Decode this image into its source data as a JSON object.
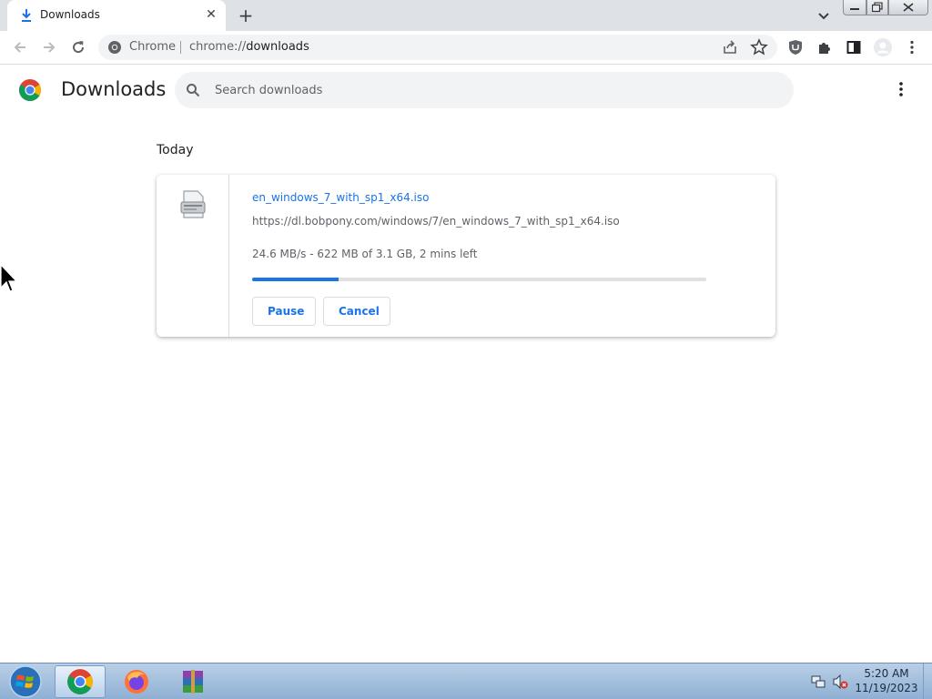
{
  "browser": {
    "tab": {
      "title": "Downloads",
      "close_glyph": "✕",
      "icon": "download-icon"
    },
    "new_tab_glyph": "+",
    "omnibox": {
      "chip_label": "Chrome",
      "url_scheme": "chrome://",
      "url_path": "downloads"
    }
  },
  "page": {
    "title": "Downloads",
    "search_placeholder": "Search downloads",
    "section_title": "Today"
  },
  "download": {
    "file_name": "en_windows_7_with_sp1_x64.iso",
    "url": "https://dl.bobpony.com/windows/7/en_windows_7_with_sp1_x64.iso",
    "status": "24.6 MB/s - 622 MB of 3.1 GB, 2 mins left",
    "progress_fraction": 0.19,
    "pause_label": "Pause",
    "cancel_label": "Cancel"
  },
  "taskbar": {
    "clock_time": "5:20 AM",
    "clock_date": "11/19/2023",
    "pinned": [
      "chrome-icon",
      "firefox-icon",
      "winrar-icon"
    ]
  },
  "colors": {
    "accent": "#1a73e8",
    "tabstrip": "#dee1e6",
    "omnibox": "#f1f3f4"
  }
}
